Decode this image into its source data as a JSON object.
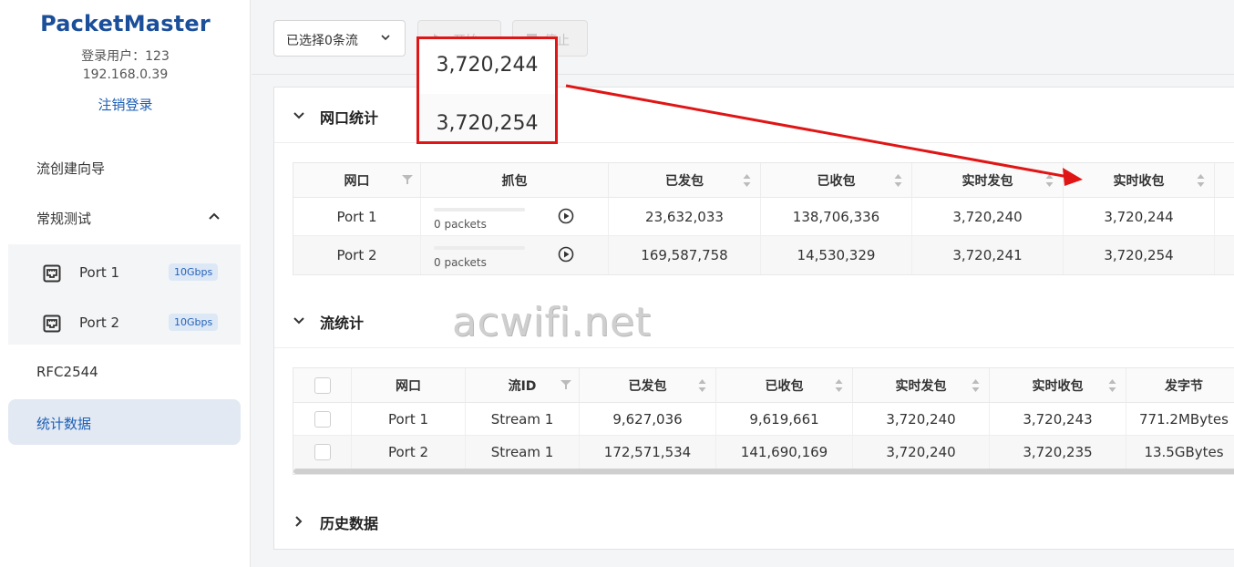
{
  "sidebar": {
    "brand": "PacketMaster",
    "user_label": "登录用户：123",
    "ip": "192.168.0.39",
    "logout": "注销登录",
    "nav": {
      "wizard": "流创建向导",
      "regular": "常规测试",
      "rfc": "RFC2544",
      "stats": "统计数据"
    },
    "ports": [
      {
        "label": "Port 1",
        "speed": "10Gbps"
      },
      {
        "label": "Port 2",
        "speed": "10Gbps"
      }
    ]
  },
  "toolbar": {
    "select_label": "已选择0条流",
    "start_label": "开始",
    "stop_label": "停止"
  },
  "port_stats": {
    "title": "网口统计",
    "headers": [
      "网口",
      "抓包",
      "已发包",
      "已收包",
      "实时发包",
      "实时收包"
    ],
    "rows": [
      {
        "port": "Port 1",
        "capture": "0 packets",
        "sent": "23,632,033",
        "recv": "138,706,336",
        "rt_sent": "3,720,240",
        "rt_recv": "3,720,244"
      },
      {
        "port": "Port 2",
        "capture": "0 packets",
        "sent": "169,587,758",
        "recv": "14,530,329",
        "rt_sent": "3,720,241",
        "rt_recv": "3,720,254"
      }
    ]
  },
  "flow_stats": {
    "title": "流统计",
    "headers": [
      "网口",
      "流ID",
      "已发包",
      "已收包",
      "实时发包",
      "实时收包",
      "发字节"
    ],
    "rows": [
      {
        "port": "Port 1",
        "flow": "Stream 1",
        "sent": "9,627,036",
        "recv": "9,619,661",
        "rt_sent": "3,720,240",
        "rt_recv": "3,720,243",
        "bytes": "771.2MBytes"
      },
      {
        "port": "Port 2",
        "flow": "Stream 1",
        "sent": "172,571,534",
        "recv": "141,690,169",
        "rt_sent": "3,720,240",
        "rt_recv": "3,720,235",
        "bytes": "13.5GBytes"
      }
    ]
  },
  "history": {
    "title": "历史数据"
  },
  "annotation": {
    "value1": "3,720,244",
    "value2": "3,720,254",
    "color": "#e01515"
  },
  "watermark": "acwifi.net",
  "colors": {
    "brand": "#1c4f9a",
    "link": "#1c5fb5",
    "active_bg": "#e2e9f3"
  }
}
